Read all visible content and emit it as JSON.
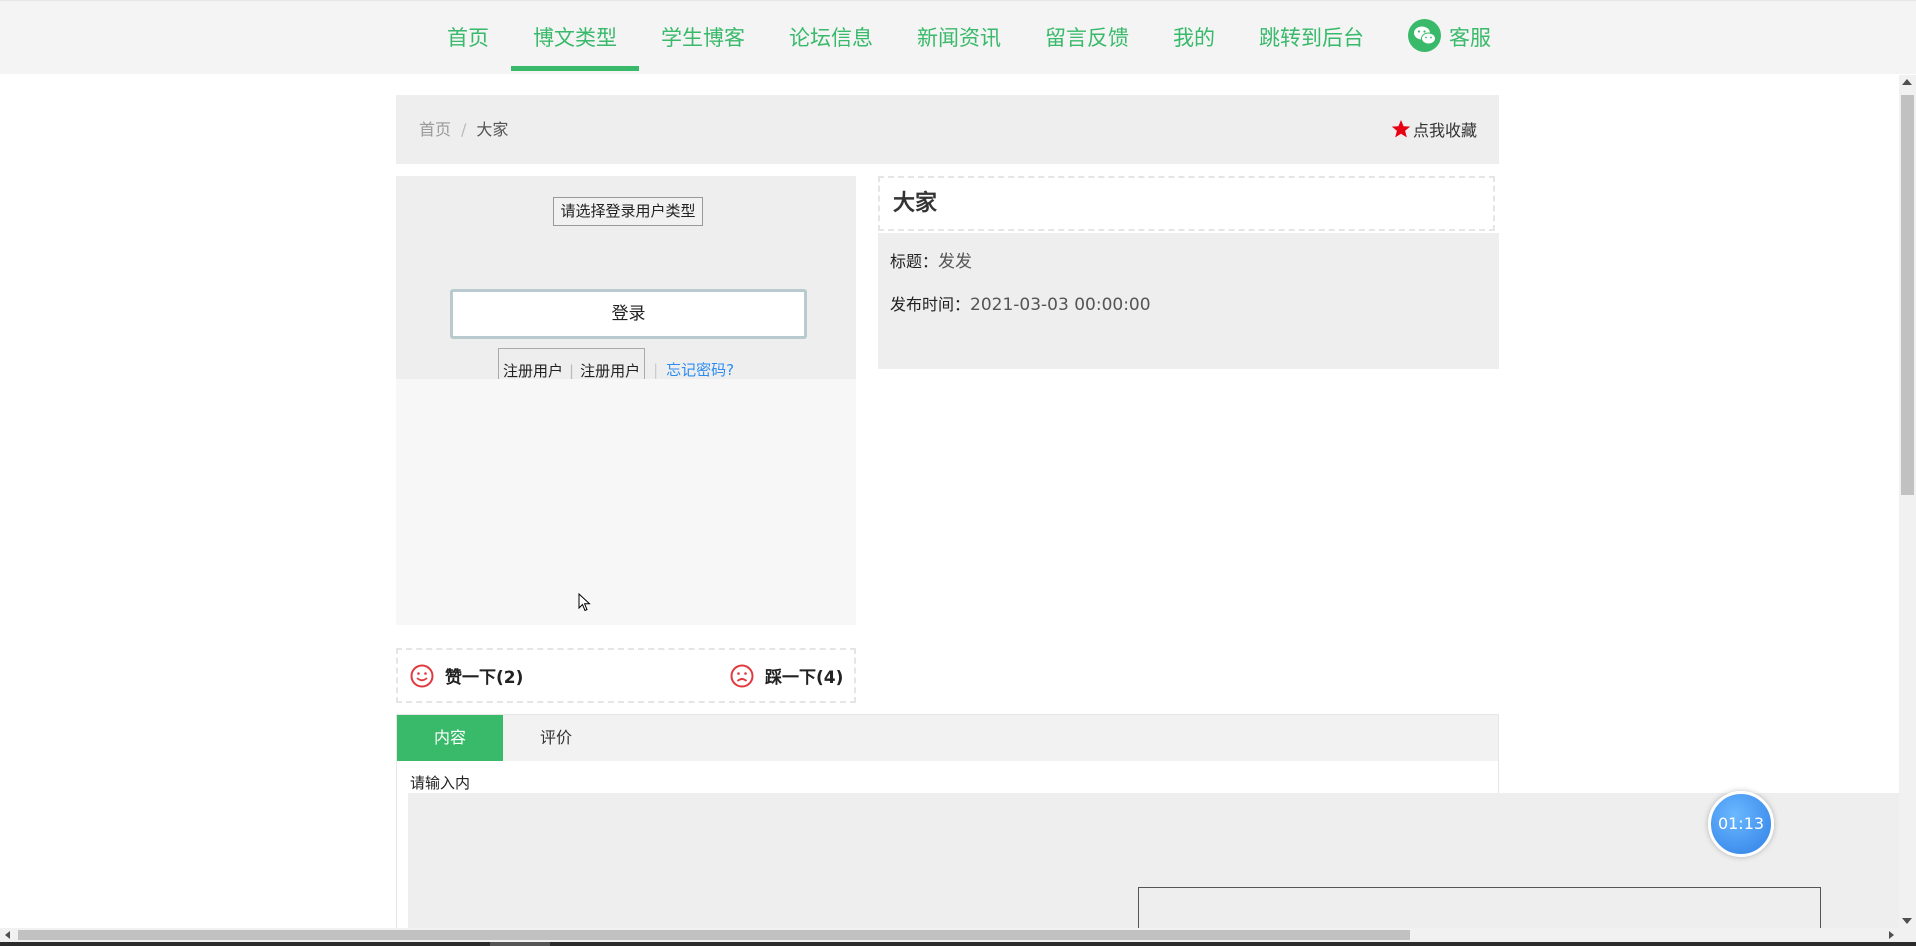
{
  "nav": {
    "items": [
      {
        "label": "首页",
        "active": false
      },
      {
        "label": "博文类型",
        "active": true
      },
      {
        "label": "学生博客",
        "active": false
      },
      {
        "label": "论坛信息",
        "active": false
      },
      {
        "label": "新闻资讯",
        "active": false
      },
      {
        "label": "留言反馈",
        "active": false
      },
      {
        "label": "我的",
        "active": false
      },
      {
        "label": "跳转到后台",
        "active": false
      }
    ],
    "service_label": "客服",
    "service_icon": "wechat-icon"
  },
  "breadcrumb": {
    "home": "首页",
    "separator": "/",
    "current": "大家",
    "favorite_label": "点我收藏",
    "favorite_icon": "star-icon"
  },
  "login": {
    "role_placeholder": "请选择登录用户类型",
    "login_button": "登录",
    "register_links": [
      "注册用户",
      "注册用户"
    ],
    "forgot_password": "忘记密码?"
  },
  "detail": {
    "title": "大家",
    "subject_label": "标题：",
    "subject_value": "发发",
    "time_label": "发布时间：",
    "time_value": "2021-03-03 00:00:00"
  },
  "votes": {
    "like_label": "赞一下(2)",
    "like_icon": "smile-icon",
    "dislike_label": "踩一下(4)",
    "dislike_icon": "frown-icon"
  },
  "tabs": {
    "items": [
      "内容",
      "评价"
    ],
    "active": "内容",
    "content_text": "请输入内"
  },
  "timer": {
    "value": "01:13"
  },
  "colors": {
    "accent": "#39b96a",
    "link": "#2d8cf0",
    "star": "#e60012",
    "face": "#e0393e",
    "timer": "#3a8ef0"
  }
}
